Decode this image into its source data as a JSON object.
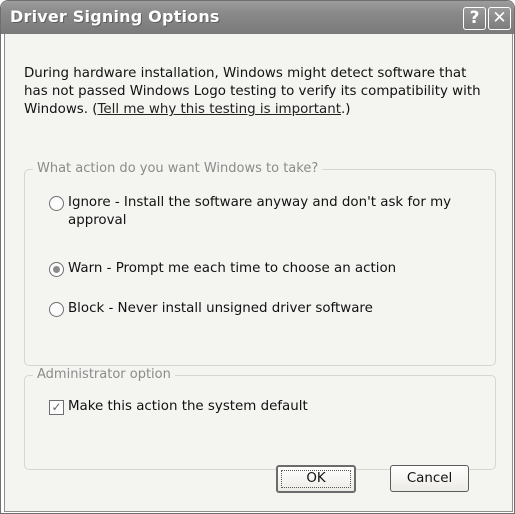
{
  "window": {
    "title": "Driver Signing Options",
    "help_glyph": "?",
    "close_glyph": "✕"
  },
  "description": {
    "text": "During hardware installation, Windows might detect software that has not passed Windows Logo testing to verify its compatibility with Windows. (",
    "link": "Tell me why this testing is important",
    "suffix": ".)"
  },
  "action_group": {
    "legend": "What action do you want Windows to take?",
    "options": [
      {
        "label": "Ignore - Install the software anyway and don't ask for my approval",
        "selected": false
      },
      {
        "label": "Warn - Prompt me each time to choose an action",
        "selected": true
      },
      {
        "label": "Block - Never install unsigned driver software",
        "selected": false
      }
    ]
  },
  "admin_group": {
    "legend": "Administrator option",
    "checkbox_label": "Make this action the system default",
    "checked": true,
    "check_glyph": "✓"
  },
  "buttons": {
    "ok": "OK",
    "cancel": "Cancel"
  }
}
